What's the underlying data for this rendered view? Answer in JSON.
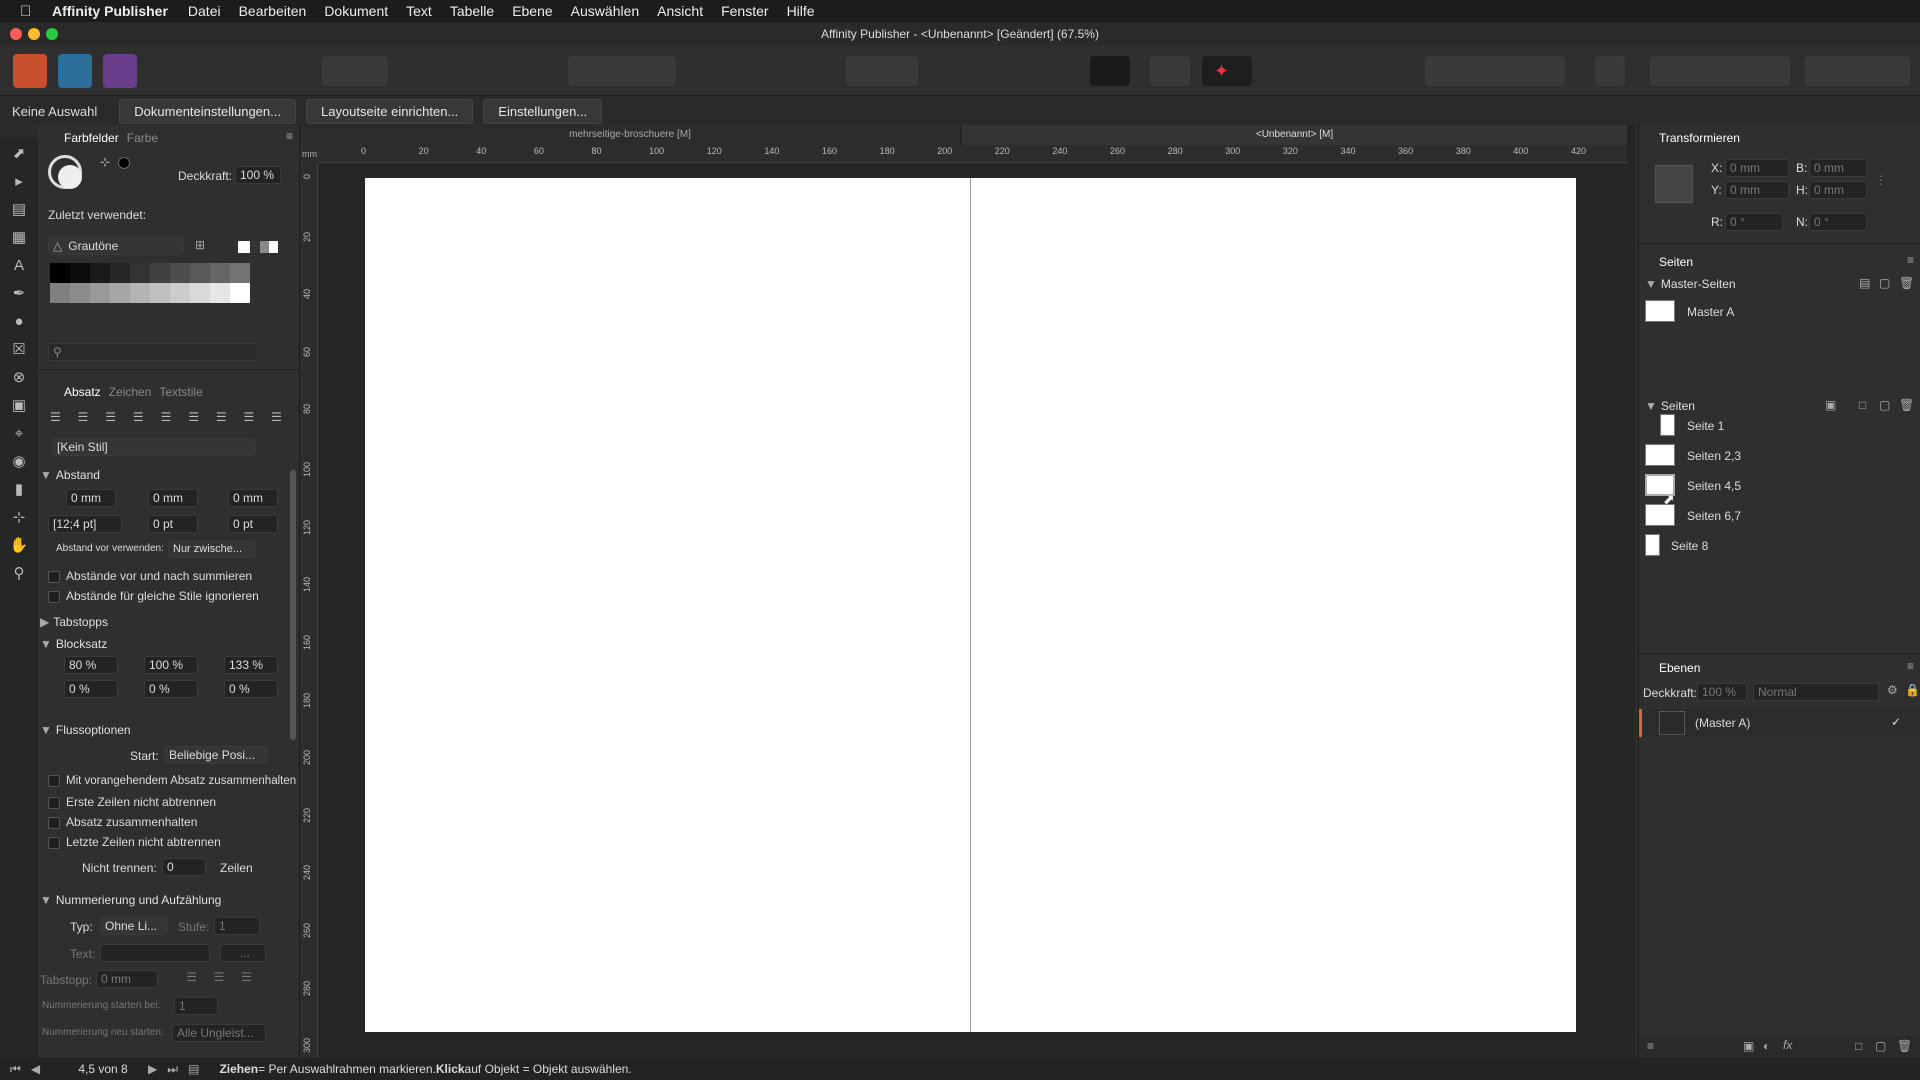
{
  "menubar": {
    "app_name": "Affinity Publisher",
    "items": [
      "Datei",
      "Bearbeiten",
      "Dokument",
      "Text",
      "Tabelle",
      "Ebene",
      "Auswählen",
      "Ansicht",
      "Fenster",
      "Hilfe"
    ]
  },
  "window": {
    "title": "Affinity Publisher - <Unbenannt> [Geändert] (67.5%)"
  },
  "contextbar": {
    "selection": "Keine Auswahl",
    "buttons": [
      "Dokumenteinstellungen...",
      "Layoutseite einrichten...",
      "Einstellungen..."
    ]
  },
  "swatches_panel": {
    "tabs": [
      "Farbfelder",
      "Farbe"
    ],
    "opacity_label": "Deckkraft:",
    "opacity_value": "100 %",
    "recent_label": "Zuletzt verwendet:",
    "palette_name": "Grautöne"
  },
  "paragraph_panel": {
    "tabs": [
      "Absatz",
      "Zeichen",
      "Textstile"
    ],
    "style": "[Kein Stil]",
    "spacing": {
      "title": "Abstand",
      "left_indent": "0 mm",
      "right_indent": "0 mm",
      "first_line": "0 mm",
      "leading": "[12;4 pt]",
      "space_before": "0 pt",
      "space_after": "0 pt",
      "use_before_label": "Abstand vor verwenden:",
      "use_before_value": "Nur zwische...",
      "check1": "Abstände vor und nach summieren",
      "check2": "Abstände für gleiche Stile ignorieren"
    },
    "tabstops_title": "Tabstopps",
    "justify": {
      "title": "Blocksatz",
      "word_min": "80 %",
      "word_desired": "100 %",
      "word_max": "133 %",
      "letter_min": "0 %",
      "letter_desired": "0 %",
      "letter_max": "0 %"
    },
    "flow": {
      "title": "Flussoptionen",
      "start_label": "Start:",
      "start_value": "Beliebige Posi...",
      "options": [
        "Mit vorangehendem Absatz zusammenhalten",
        "Erste Zeilen nicht abtrennen",
        "Absatz zusammenhalten",
        "Letzte Zeilen nicht abtrennen"
      ],
      "no_break_label": "Nicht trennen:",
      "no_break_value": "0",
      "no_break_unit": "Zeilen"
    },
    "numbering": {
      "title": "Nummerierung und Aufzählung",
      "type_label": "Typ:",
      "type_value": "Ohne Li...",
      "level_label": "Stufe:",
      "level_value": "1",
      "text_label": "Text:",
      "text_button": "...",
      "tabstop_label": "Tabstopp:",
      "tabstop_value": "0 mm",
      "start_at_label": "Nummerierung starten bei:",
      "start_at_value": "1",
      "restart_label": "Nummerierung neu starten:",
      "restart_value": "Alle Ungleist..."
    }
  },
  "document": {
    "tab_left": "mehrseitige-broschuere [M]",
    "tab_right": "<Unbenannt> [M]",
    "ruler_unit": "mm",
    "ruler_h": [
      "0",
      "20",
      "40",
      "60",
      "80",
      "100",
      "120",
      "140",
      "160",
      "180",
      "200",
      "220",
      "240",
      "260",
      "280",
      "300",
      "320",
      "340",
      "360",
      "380",
      "400",
      "420"
    ],
    "ruler_v": [
      "0",
      "20",
      "40",
      "60",
      "80",
      "100",
      "120",
      "140",
      "160",
      "180",
      "200",
      "220",
      "240",
      "260",
      "280",
      "300"
    ]
  },
  "transform_panel": {
    "title": "Transformieren",
    "x_label": "X:",
    "x_value": "0 mm",
    "y_label": "Y:",
    "y_value": "0 mm",
    "w_label": "B:",
    "w_value": "0 mm",
    "h_label": "H:",
    "h_value": "0 mm",
    "r_label": "R:",
    "r_value": "0 °",
    "n_label": "N:",
    "n_value": "0 °"
  },
  "pages_panel": {
    "title": "Seiten",
    "master_title": "Master-Seiten",
    "masters": [
      "Master A"
    ],
    "pages_title": "Seiten",
    "pages": [
      "Seite 1",
      "Seiten 2,3",
      "Seiten 4,5",
      "Seiten 6,7",
      "Seite 8"
    ]
  },
  "layers_panel": {
    "title": "Ebenen",
    "opacity_label": "Deckkraft:",
    "opacity_value": "100 %",
    "blend_mode": "Normal",
    "layers": [
      "(Master A)"
    ]
  },
  "statusbar": {
    "page_indicator": "4,5 von 8",
    "hint_drag": "Ziehen",
    "hint_drag_text": " = Per Auswahlrahmen markieren. ",
    "hint_click": "Klick",
    "hint_click_text": " auf Objekt = Objekt auswählen."
  }
}
